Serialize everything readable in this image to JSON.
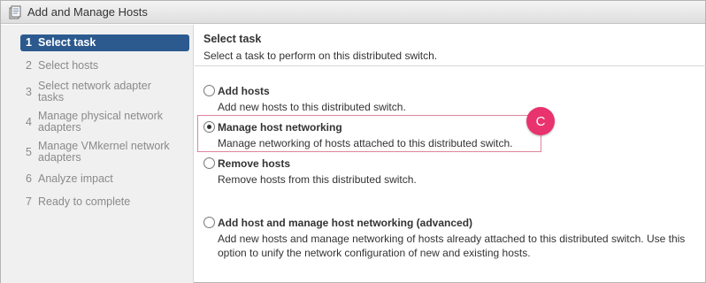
{
  "window": {
    "title": "Add and Manage Hosts",
    "icon": "wizard-icon"
  },
  "sidebar": {
    "steps": [
      {
        "num": "1",
        "label": "Select task",
        "active": true
      },
      {
        "num": "2",
        "label": "Select hosts",
        "active": false
      },
      {
        "num": "3",
        "label": "Select network adapter tasks",
        "active": false
      },
      {
        "num": "4",
        "label": "Manage physical network adapters",
        "active": false
      },
      {
        "num": "5",
        "label": "Manage VMkernel network adapters",
        "active": false
      },
      {
        "num": "6",
        "label": "Analyze impact",
        "active": false
      },
      {
        "num": "7",
        "label": "Ready to complete",
        "active": false
      }
    ]
  },
  "main": {
    "title": "Select task",
    "subtitle": "Select a task to perform on this distributed switch.",
    "options": [
      {
        "title": "Add hosts",
        "desc": "Add new hosts to this distributed switch.",
        "selected": false
      },
      {
        "title": "Manage host networking",
        "desc": "Manage networking of hosts attached to this distributed switch.",
        "selected": true
      },
      {
        "title": "Remove hosts",
        "desc": "Remove hosts from this distributed switch.",
        "selected": false
      },
      {
        "title": "Add host and manage host networking (advanced)",
        "desc": "Add new hosts and manage networking of hosts already attached to this distributed switch. Use this option to unify the network configuration of new and existing hosts.",
        "selected": false
      }
    ],
    "callout_badge": "C"
  },
  "colors": {
    "active_step_bg": "#2c5a8f",
    "highlight_border": "#e0849c",
    "badge_bg": "#e8336e"
  }
}
